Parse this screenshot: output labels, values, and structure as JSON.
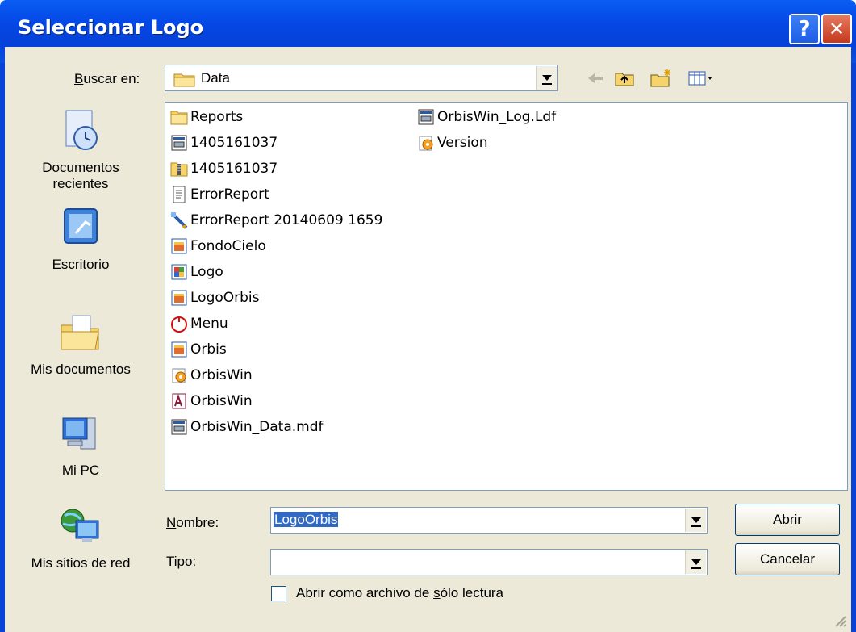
{
  "window": {
    "title": "Seleccionar Logo",
    "help_glyph": "?",
    "close_glyph": "✕"
  },
  "lookin": {
    "label_u": "B",
    "label_rest": "uscar en:",
    "value": "Data"
  },
  "places": [
    {
      "label1": "Documentos",
      "label2": "recientes",
      "icon": "recent-documents-icon"
    },
    {
      "label1": "Escritorio",
      "label2": "",
      "icon": "desktop-icon"
    },
    {
      "label1": "Mis documentos",
      "label2": "",
      "icon": "my-documents-icon"
    },
    {
      "label1": "Mi PC",
      "label2": "",
      "icon": "my-computer-icon"
    },
    {
      "label1": "Mis sitios de red",
      "label2": "",
      "icon": "network-places-icon"
    }
  ],
  "files": [
    {
      "name": "Reports",
      "icon": "folder-icon"
    },
    {
      "name": "1405161037",
      "icon": "db-file-icon"
    },
    {
      "name": "1405161037",
      "icon": "zip-folder-icon"
    },
    {
      "name": "ErrorReport",
      "icon": "text-file-icon"
    },
    {
      "name": "ErrorReport 20140609 1659",
      "icon": "shortcut-icon"
    },
    {
      "name": "FondoCielo",
      "icon": "image-file-icon"
    },
    {
      "name": "Logo",
      "icon": "bitmap-file-icon"
    },
    {
      "name": "LogoOrbis",
      "icon": "image-file-icon"
    },
    {
      "name": "Menu",
      "icon": "menu-file-icon"
    },
    {
      "name": "Orbis",
      "icon": "image-file-icon"
    },
    {
      "name": "OrbisWin",
      "icon": "config-file-icon"
    },
    {
      "name": "OrbisWin",
      "icon": "access-file-icon"
    },
    {
      "name": "OrbisWin_Data.mdf",
      "icon": "db-file-icon"
    },
    {
      "name": "OrbisWin_Log.Ldf",
      "icon": "db-file-icon"
    },
    {
      "name": "Version",
      "icon": "config-file-icon"
    }
  ],
  "filename": {
    "label_u": "N",
    "label_rest": "ombre:",
    "value": "LogoOrbis"
  },
  "filetype": {
    "label_pre": "Tip",
    "label_u": "o",
    "label_rest": ":",
    "value": ""
  },
  "buttons": {
    "open_u": "A",
    "open_rest": "brir",
    "cancel": "Cancelar"
  },
  "readonly": {
    "pre": "Abrir como archivo de ",
    "u": "s",
    "rest": "ólo lectura",
    "checked": false
  },
  "colors": {
    "titlebar": "#0548e6",
    "dialog_bg": "#ece9d8",
    "selection": "#316ac5",
    "close_red": "#c5381d"
  }
}
